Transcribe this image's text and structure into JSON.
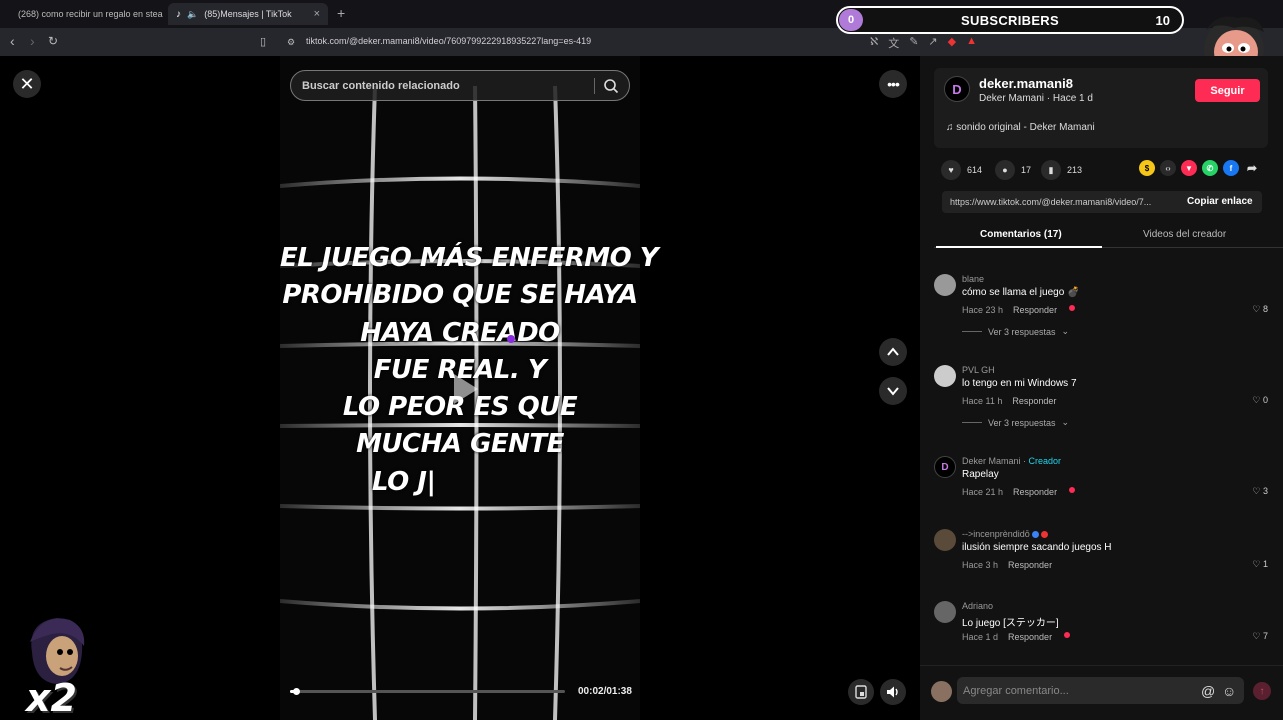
{
  "browser": {
    "tabs": [
      {
        "label": "(268) como recibir un regalo en stea",
        "icon": "youtube-icon"
      },
      {
        "label": "(85)Mensajes | TikTok",
        "icon": "tiktok-icon"
      }
    ],
    "url": "tiktok.com/@deker.mamani8/video/7609799222918935227lang=es-419"
  },
  "overlay": {
    "subscribers_current": "0",
    "subscribers_label": "SUBSCRIBERS",
    "subscribers_goal": "10",
    "multiplier": "x2"
  },
  "player": {
    "search_placeholder": "Buscar contenido relacionado",
    "caption_lines": [
      "EL JUEGO MÁS ENFERMO Y",
      "PROHIBIDO QUE SE HAYA",
      "HAYA CREADO",
      "FUE REAL. Y",
      "LO PEOR ES QUE",
      "MUCHA GENTE",
      "LO J|"
    ],
    "time": "00:02/01:38",
    "progress": 0.02
  },
  "creator": {
    "username": "deker.mamani8",
    "meta": "Deker Mamani · Hace 1 d",
    "follow_label": "Seguir",
    "music": "sonido original - Deker Mamani"
  },
  "stats": {
    "likes": "614",
    "comments": "17",
    "saves": "213"
  },
  "share": {
    "link": "https://www.tiktok.com/@deker.mamani8/video/7...",
    "copy_label": "Copiar enlace"
  },
  "panel_tabs": {
    "comments": "Comentarios (17)",
    "creator_videos": "Videos del creador"
  },
  "comments": [
    {
      "user": "blane",
      "text": "cómo se llama el juego 💣",
      "time": "Hace 23 h",
      "reply": "Responder",
      "likes": "8",
      "replies": "Ver 3 respuestas",
      "creator": false
    },
    {
      "user": "PVL GH",
      "text": "lo tengo en mi Windows 7",
      "time": "Hace 11 h",
      "reply": "Responder",
      "likes": "0",
      "replies": "Ver 3 respuestas",
      "creator": false
    },
    {
      "user": "Deker Mamani",
      "creator_label": "Creador",
      "text": "Rapelay",
      "time": "Hace 21 h",
      "reply": "Responder",
      "likes": "3",
      "creator": true
    },
    {
      "user": "-->incenprèndidō",
      "text": "ilusión siempre sacando juegos H",
      "time": "Hace 3 h",
      "reply": "Responder",
      "likes": "1",
      "creator": false
    },
    {
      "user": "Adriano",
      "text": "Lo juego [ステッカー]",
      "time": "Hace 1 d",
      "reply": "Responder",
      "likes": "7",
      "creator": false
    }
  ],
  "add_comment": {
    "placeholder": "Agregar comentario..."
  },
  "colors": {
    "accent": "#fe2c55",
    "creator": "#20d5ec",
    "panel_bg": "#121212"
  }
}
